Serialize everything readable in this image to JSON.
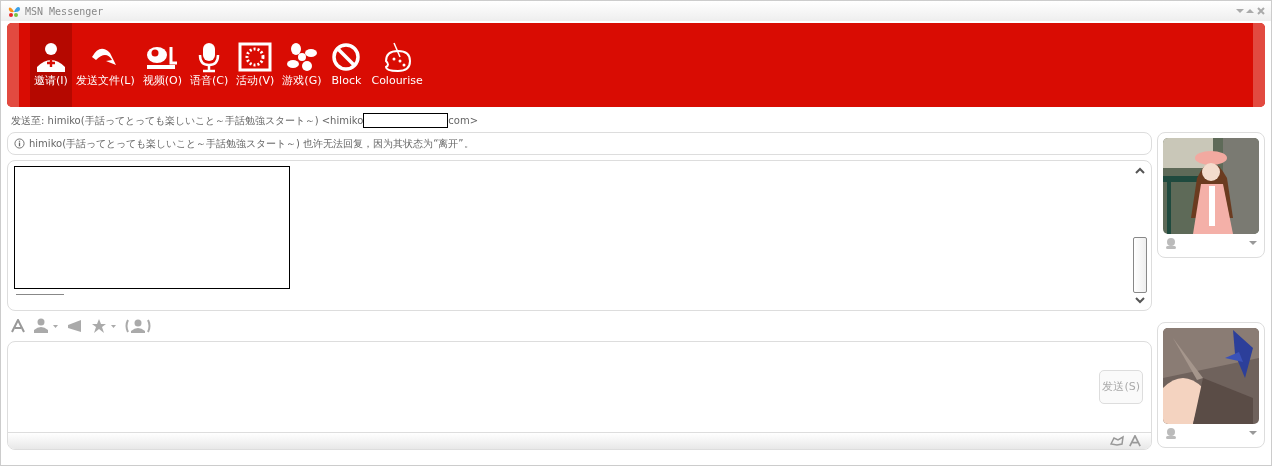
{
  "window": {
    "title": "MSN Messenger"
  },
  "toolbar": [
    {
      "label": "邀请(I)",
      "kind": "invite",
      "selected": true
    },
    {
      "label": "发送文件(L)",
      "kind": "file",
      "selected": false
    },
    {
      "label": "视频(O)",
      "kind": "video",
      "selected": false
    },
    {
      "label": "语音(C)",
      "kind": "voice",
      "selected": false
    },
    {
      "label": "活动(V)",
      "kind": "activity",
      "selected": false
    },
    {
      "label": "游戏(G)",
      "kind": "games",
      "selected": false
    },
    {
      "label": "Block",
      "kind": "block",
      "selected": false
    },
    {
      "label": "Colourise",
      "kind": "colourise",
      "selected": false
    }
  ],
  "send_to": {
    "text": "发送至: himiko(手話ってとっても楽しいこと～手話勉強スタート～) <himiko",
    "suffix": "com>"
  },
  "notice": "himiko(手話ってとっても楽しいこと～手話勉強スタート～) 也许无法回复，因为其状态为“离开”。",
  "compose": {
    "send_button": {
      "label": "发送(S)",
      "disabled": true
    }
  }
}
